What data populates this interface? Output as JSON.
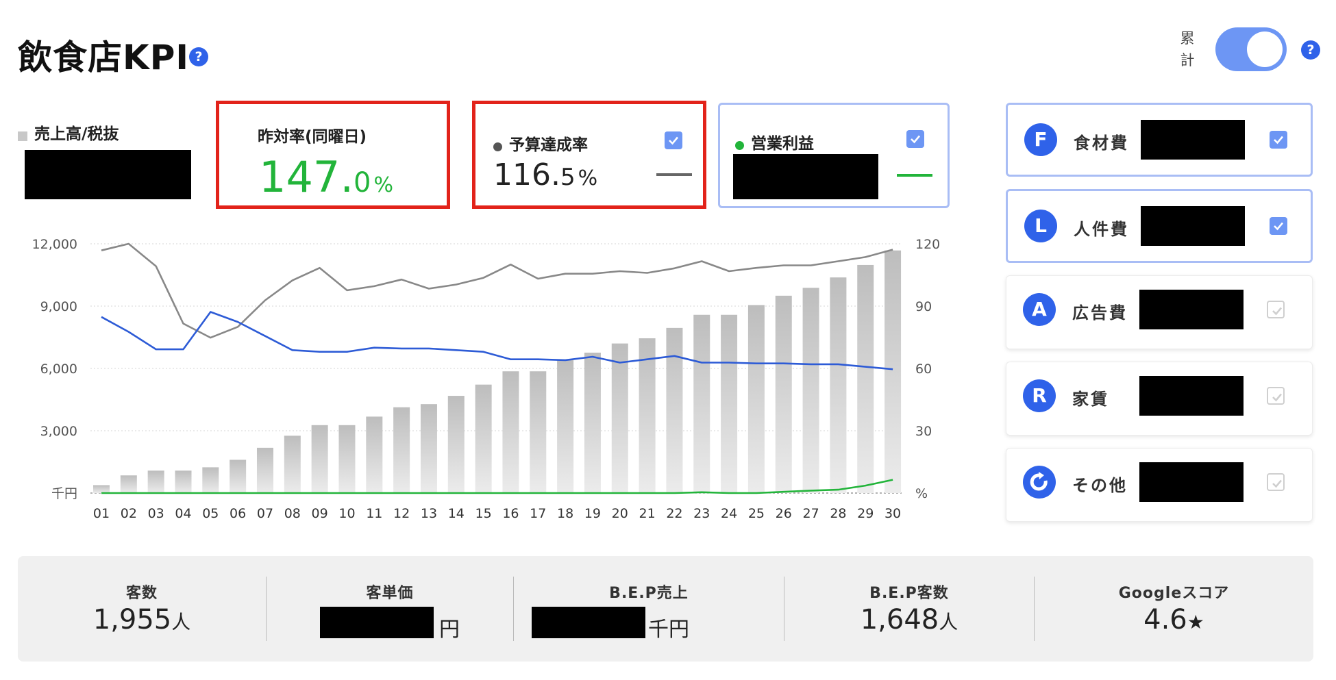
{
  "header": {
    "title": "飲食店KPI",
    "help_label": "?",
    "cumulative_label": "累計"
  },
  "sales": {
    "legend_label": "売上高/税抜"
  },
  "yoy": {
    "label": "昨対率(同曜日)",
    "value_int": "147.",
    "value_dec": "0",
    "unit": "%",
    "color": "#22b43a"
  },
  "budget": {
    "label": "予算達成率",
    "value_int": "116.",
    "value_dec": "5",
    "unit": "%",
    "checked": true,
    "dot_color": "#555555"
  },
  "profit": {
    "label": "営業利益",
    "checked": true,
    "dot_color": "#22b43a"
  },
  "costs": [
    {
      "letter": "F",
      "label": "食材費",
      "checked": true
    },
    {
      "letter": "L",
      "label": "人件費",
      "checked": true
    },
    {
      "letter": "A",
      "label": "広告費",
      "checked": false
    },
    {
      "letter": "R",
      "label": "家賃",
      "checked": false
    },
    {
      "icon": "cycle-icon",
      "label": "その他",
      "checked": false
    }
  ],
  "chart_data": {
    "type": "bar",
    "categories": [
      "01",
      "02",
      "03",
      "04",
      "05",
      "06",
      "07",
      "08",
      "09",
      "10",
      "11",
      "12",
      "13",
      "14",
      "15",
      "16",
      "17",
      "18",
      "19",
      "20",
      "21",
      "22",
      "23",
      "24",
      "25",
      "26",
      "27",
      "28",
      "29",
      "30"
    ],
    "left_axis": {
      "unit_label": "千円",
      "ticks": [
        "12,000",
        "9,000",
        "6,000",
        "3,000"
      ],
      "ylim": [
        0,
        12000
      ]
    },
    "right_axis": {
      "unit_label": "%",
      "ticks": [
        "120",
        "90",
        "60",
        "30"
      ],
      "ylim": [
        0,
        120
      ]
    },
    "grid": true,
    "series": [
      {
        "type": "bar",
        "values": [
          380,
          850,
          1080,
          1080,
          1240,
          1600,
          2180,
          2760,
          3270,
          3270,
          3680,
          4130,
          4280,
          4680,
          5220,
          5860,
          5860,
          6420,
          6760,
          7200,
          7450,
          7950,
          8580,
          8580,
          9050,
          9500,
          9880,
          10380,
          10980,
          11680
        ],
        "color": "#c4c4c4"
      },
      {
        "type": "line",
        "axis": "right",
        "values": [
          116.8,
          120,
          109.2,
          81.6,
          74.8,
          80,
          92.8,
          102.4,
          108.4,
          97.6,
          99.6,
          102.8,
          98.4,
          100.4,
          103.6,
          110,
          103.2,
          105.6,
          105.6,
          106.8,
          106,
          108.2,
          111.6,
          106.8,
          108.4,
          109.6,
          109.6,
          111.6,
          113.6,
          117.2
        ],
        "color": "#888888"
      },
      {
        "type": "line",
        "axis": "right",
        "values": [
          84.8,
          77.6,
          69.2,
          69.2,
          87.2,
          82.4,
          75.6,
          68.8,
          68,
          68,
          70,
          69.6,
          69.6,
          68.8,
          68,
          64.4,
          64.4,
          64,
          65.6,
          62.8,
          64.4,
          66,
          62.8,
          62.8,
          62.4,
          62.4,
          62,
          62,
          60.8,
          59.6
        ],
        "color": "#2d5bd6"
      },
      {
        "type": "line",
        "axis": "right",
        "values": [
          0,
          0,
          0,
          0,
          0,
          0,
          0,
          0,
          0,
          0,
          0,
          0,
          0,
          0,
          0,
          0,
          0,
          0,
          0,
          0,
          0,
          0,
          0.4,
          0,
          0,
          0.6,
          1.2,
          1.6,
          3.6,
          6.4
        ],
        "color": "#22b43a"
      }
    ]
  },
  "stats": [
    {
      "label": "客数",
      "value": "1,955",
      "unit": "人",
      "redacted": false
    },
    {
      "label": "客単価",
      "value": "",
      "unit": "円",
      "redacted": true
    },
    {
      "label": "B.E.P売上",
      "value": "",
      "unit": "千円",
      "redacted": true
    },
    {
      "label": "B.E.P客数",
      "value": "1,648",
      "unit": "人",
      "redacted": false
    },
    {
      "label": "Googleスコア",
      "value": "4.6",
      "unit": "★",
      "redacted": false
    }
  ]
}
